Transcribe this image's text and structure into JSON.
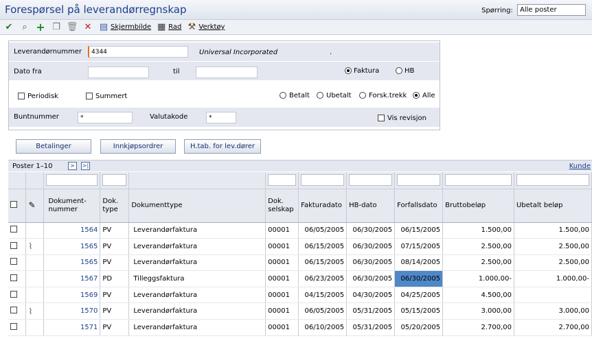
{
  "title": "Forespørsel på leverandørregnskap",
  "query": {
    "label": "Spørring:",
    "value": "Alle poster"
  },
  "toolbar": {
    "screen": "Skjermbilde",
    "row": "Rad",
    "tools": "Verktøy"
  },
  "form": {
    "supplier_label": "Leverandørnummer",
    "supplier_value": "4344",
    "supplier_name": "Universal Incorporated",
    "dot": ".",
    "date_from_label": "Dato fra",
    "date_to_label": "til",
    "invoice_radio": "Faktura",
    "hb_radio": "HB",
    "periodic": "Periodisk",
    "summed": "Summert",
    "paid": "Betalt",
    "unpaid": "Ubetalt",
    "prepay": "Forsk.trekk",
    "all": "Alle",
    "batch_label": "Buntnummer",
    "batch_value": "*",
    "currency_label": "Valutakode",
    "currency_value": "*",
    "revision": "Vis revisjon"
  },
  "buttons": {
    "payments": "Betalinger",
    "purchase": "Innkjøpsordrer",
    "htab": "H.tab. for lev.dører"
  },
  "grid": {
    "paging": "Poster 1–10",
    "customize": "Kunde",
    "headers": {
      "doc_no": "Dokument-nummer",
      "doc_type": "Dok. type",
      "doc_type_name": "Dokumenttype",
      "doc_company": "Dok. selskap",
      "invoice_date": "Fakturadato",
      "hb_date": "HB-dato",
      "due_date": "Forfallsdato",
      "gross": "Bruttobeløp",
      "unpaid": "Ubetalt beløp"
    },
    "rows": [
      {
        "doc": "1564",
        "type": "PV",
        "name": "Leverandørfaktura",
        "co": "00001",
        "inv": "06/05/2005",
        "hb": "06/30/2005",
        "due": "06/15/2005",
        "gross": "1.500,00",
        "open": "1.500,00",
        "attach": false,
        "hl": false
      },
      {
        "doc": "1565",
        "type": "PV",
        "name": "Leverandørfaktura",
        "co": "00001",
        "inv": "06/15/2005",
        "hb": "06/30/2005",
        "due": "07/15/2005",
        "gross": "2.500,00",
        "open": "2.500,00",
        "attach": true,
        "hl": false
      },
      {
        "doc": "1565",
        "type": "PV",
        "name": "Leverandørfaktura",
        "co": "00001",
        "inv": "06/15/2005",
        "hb": "06/30/2005",
        "due": "08/14/2005",
        "gross": "2.500,00",
        "open": "2.500,00",
        "attach": false,
        "hl": false
      },
      {
        "doc": "1567",
        "type": "PD",
        "name": "Tilleggsfaktura",
        "co": "00001",
        "inv": "06/23/2005",
        "hb": "06/30/2005",
        "due": "06/30/2005",
        "gross": "1.000,00-",
        "open": "1.000,00-",
        "attach": false,
        "hl": true
      },
      {
        "doc": "1569",
        "type": "PV",
        "name": "Leverandørfaktura",
        "co": "00001",
        "inv": "04/15/2005",
        "hb": "04/30/2005",
        "due": "04/25/2005",
        "gross": "4.500,00",
        "open": "",
        "attach": false,
        "hl": false
      },
      {
        "doc": "1570",
        "type": "PV",
        "name": "Leverandørfaktura",
        "co": "00001",
        "inv": "06/05/2005",
        "hb": "05/31/2005",
        "due": "05/15/2005",
        "gross": "3.000,00",
        "open": "3.000,00",
        "attach": true,
        "hl": false
      },
      {
        "doc": "1571",
        "type": "PV",
        "name": "Leverandørfaktura",
        "co": "00001",
        "inv": "06/10/2005",
        "hb": "05/31/2005",
        "due": "05/20/2005",
        "gross": "2.700,00",
        "open": "2.700,00",
        "attach": false,
        "hl": false
      }
    ]
  }
}
